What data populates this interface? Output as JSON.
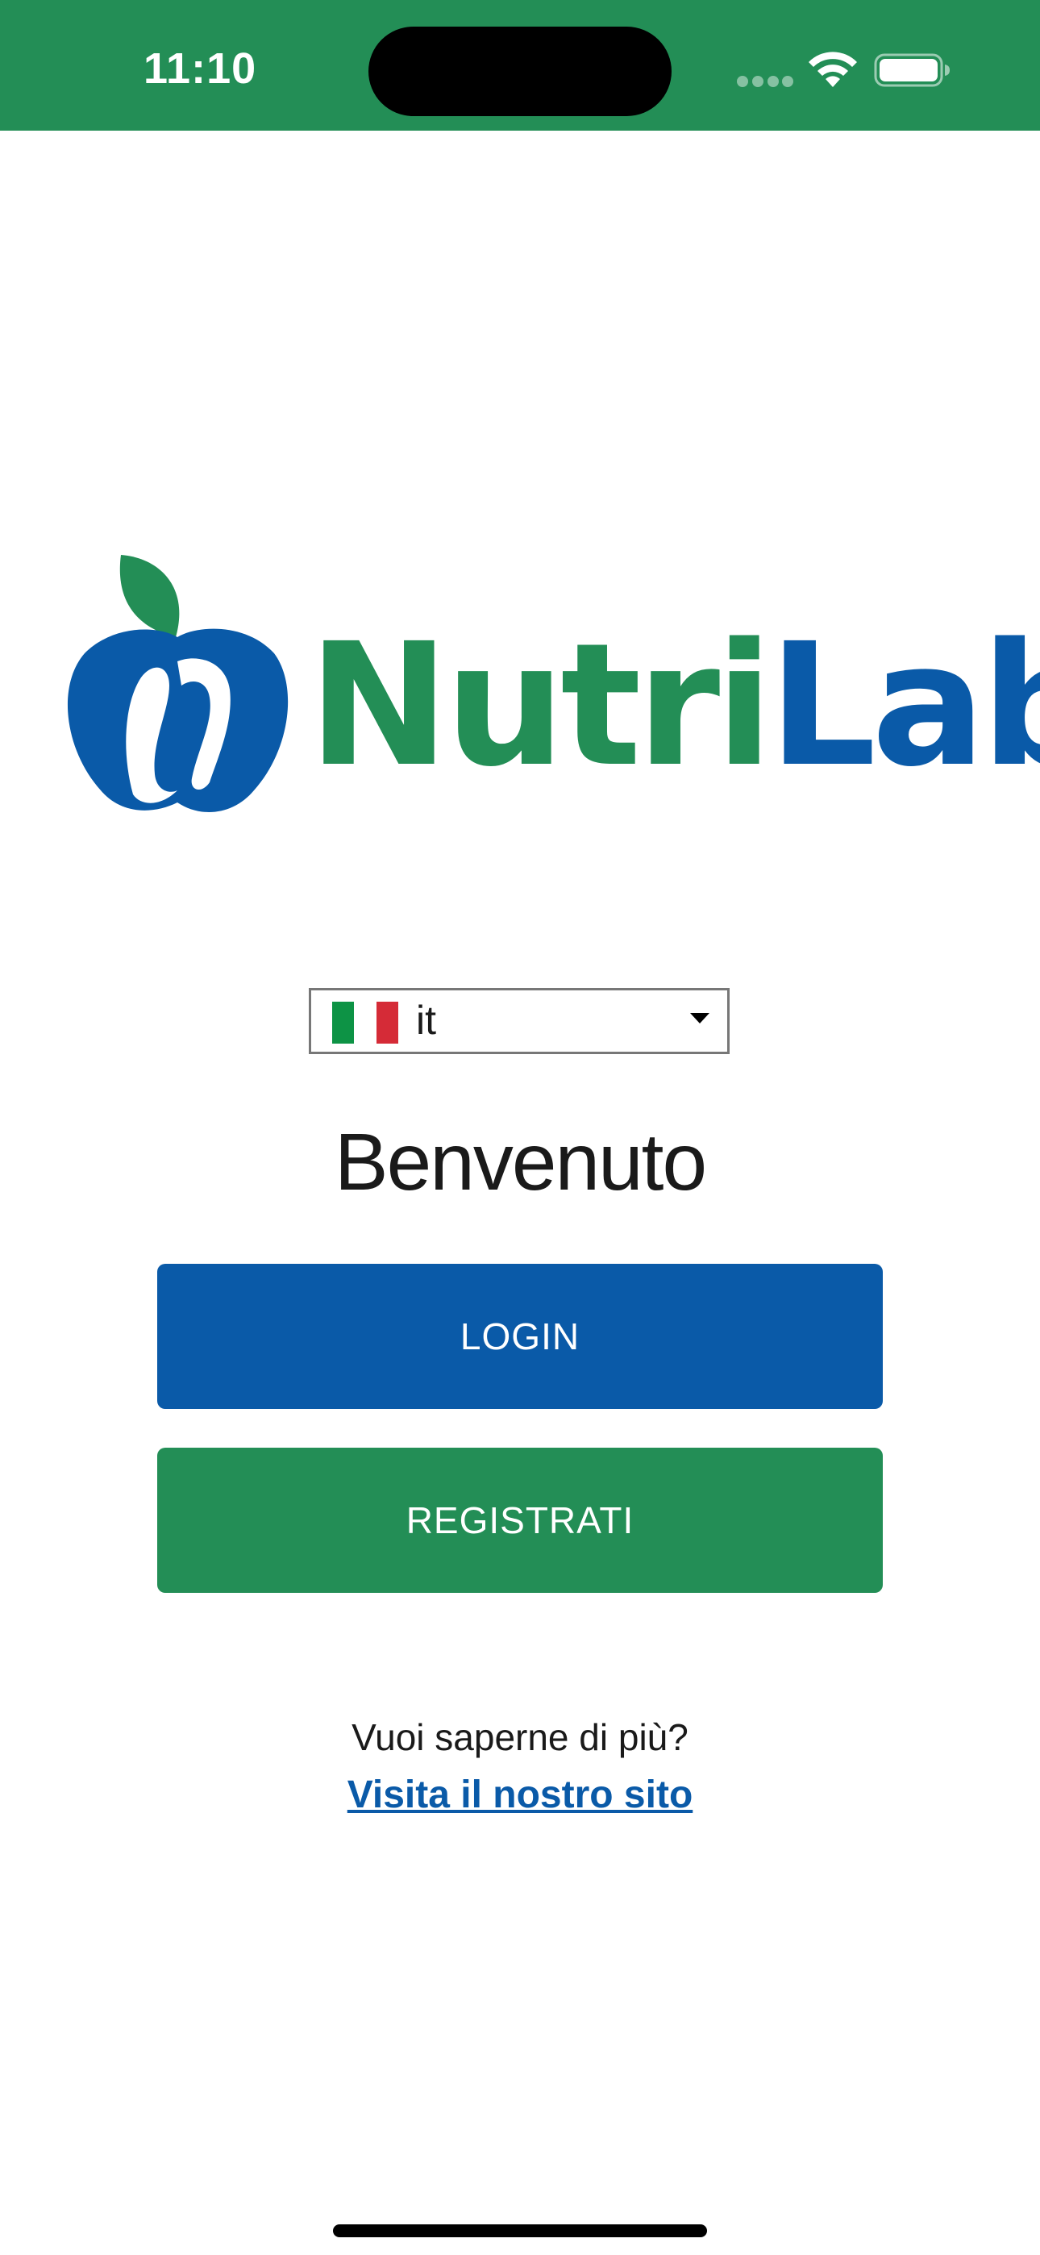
{
  "status_bar": {
    "time": "11:10",
    "background": "#238E56",
    "icons": [
      "signal-dots-icon",
      "wifi-icon",
      "battery-icon"
    ]
  },
  "logo": {
    "word_part1": "Nutri",
    "word_part2": "Lab",
    "green": "#238E56",
    "blue": "#0A5AA8"
  },
  "language": {
    "flag": "italy-flag-icon",
    "value": "it",
    "flag_colors": [
      "#0D9345",
      "#FFFFFF",
      "#D52B37"
    ]
  },
  "welcome": {
    "title": "Benvenuto"
  },
  "buttons": {
    "login_label": "LOGIN",
    "login_color": "#0A5AA8",
    "register_label": "REGISTRATI",
    "register_color": "#238E56"
  },
  "footer": {
    "question": "Vuoi saperne di più?",
    "link_label": "Visita il nostro sito"
  }
}
